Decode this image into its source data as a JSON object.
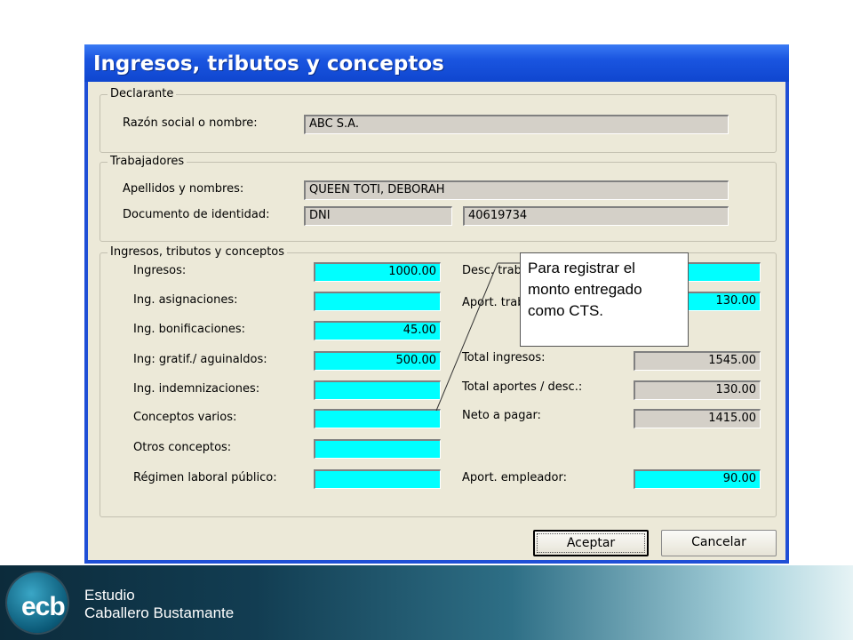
{
  "window": {
    "title": "Ingresos, tributos y conceptos",
    "accent": "#1f4fd6"
  },
  "declarante": {
    "legend": "Declarante",
    "razon_label": "Razón social o nombre:",
    "razon_value": "ABC S.A."
  },
  "trabajadores": {
    "legend": "Trabajadores",
    "apellidos_label": "Apellidos y nombres:",
    "apellidos_value": "QUEEN TOTI, DEBORAH",
    "documento_label": "Documento de identidad:",
    "doc_type": "DNI",
    "doc_number": "40619734"
  },
  "conceptos": {
    "legend": "Ingresos, tributos y conceptos",
    "left": [
      {
        "label": "Ingresos:",
        "value": "1000.00"
      },
      {
        "label": "Ing. asignaciones:",
        "value": ""
      },
      {
        "label": "Ing. bonificaciones:",
        "value": "45.00"
      },
      {
        "label": "Ing: gratif./ aguinaldos:",
        "value": "500.00"
      },
      {
        "label": "Ing. indemnizaciones:",
        "value": ""
      },
      {
        "label": "Conceptos varios:",
        "value": ""
      },
      {
        "label": "Otros conceptos:",
        "value": ""
      },
      {
        "label": "Régimen laboral público:",
        "value": ""
      }
    ],
    "right": [
      {
        "label": "Desc. trab",
        "value": ""
      },
      {
        "label": "Aport. trab",
        "value": "130.00"
      },
      {
        "label": "Total ingresos:",
        "value": "1545.00"
      },
      {
        "label": "Total aportes / desc.:",
        "value": "130.00"
      },
      {
        "label": "Neto a pagar:",
        "value": "1415.00"
      },
      {
        "label": "Aport. empleador:",
        "value": "90.00"
      }
    ]
  },
  "buttons": {
    "accept": "Aceptar",
    "cancel": "Cancelar"
  },
  "callout": {
    "line1": "Para registrar el",
    "line2": "monto entregado",
    "line3": "como CTS."
  },
  "brand": {
    "logo": "ecb",
    "line1": "Estudio",
    "line2": "Caballero Bustamante"
  },
  "colors": {
    "field_cyan": "#00ffff",
    "field_readonly": "#d4d0c8",
    "dialog_bg": "#ece9d8"
  }
}
